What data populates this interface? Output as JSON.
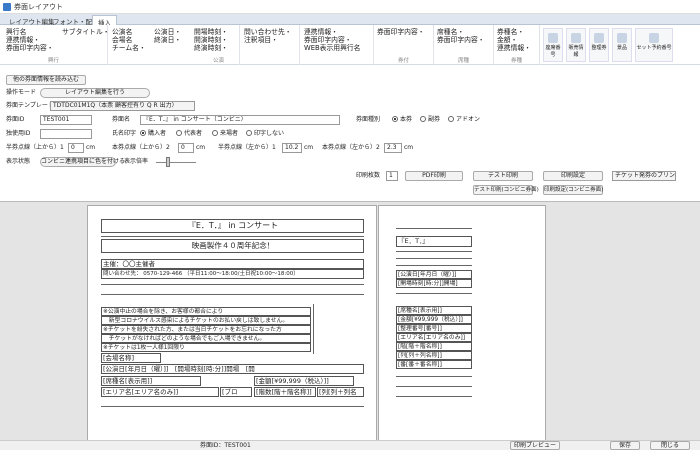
{
  "window": {
    "title": "券面レイアウト"
  },
  "tabs": [
    "レイアウト編集",
    "フォント・配置",
    "挿入"
  ],
  "ribbon": {
    "g1": {
      "items": [
        "興行名",
        "連携情報・",
        "券面印字内容・",
        "サブタイトル・"
      ],
      "label": "興行"
    },
    "g2": {
      "items": [
        "公演名",
        "会場名",
        "チーム名・"
      ]
    },
    "g3": {
      "items": [
        "公演日・",
        "終演日・"
      ]
    },
    "g4": {
      "items": [
        "開場時刻・",
        "開演時刻・",
        "終演時刻・"
      ],
      "label": "公演"
    },
    "g5": {
      "items": [
        "問い合わせ先・",
        "注釈項目・"
      ]
    },
    "g6": {
      "items": [
        "連携情報・",
        "券面印字内容・",
        "WEB表示用興行名"
      ]
    },
    "g7": {
      "items": [
        "券面印字内容・"
      ],
      "label": "券付"
    },
    "g8": {
      "items": [
        "席種名・",
        "券面印字内容・"
      ],
      "label": "席種"
    },
    "g9": {
      "items": [
        "券種名・",
        "金額・",
        "連携情報・"
      ],
      "label": "券種"
    },
    "big": [
      "座席番号",
      "販売情報",
      "整理券",
      "景品",
      "セット予約番号"
    ]
  },
  "form": {
    "load_button": "他の券面情報を読み込む",
    "mode_label": "操作モード",
    "mode_button": "レイアウト編集を行う",
    "template_label": "券面テンプレート",
    "template_value": "TDTDC01M1Q（本票 顧客控有り Q R 出力）",
    "id_label": "券面ID",
    "id_value": "TEST001",
    "name_label": "券面名",
    "name_value": "『E．T．』 in コンサート（コンビニ）",
    "type_label": "券面種別",
    "type_options": [
      "本券",
      "副券",
      "アドオン"
    ],
    "maker_label": "独使用ID",
    "print_label": "氏名印字",
    "print_options": [
      "購入者",
      "代表者",
      "来場者",
      "印字しない"
    ],
    "pos_top_label": "半券点線（上から）1",
    "pos_top_value": "0",
    "unit": "cm",
    "pos_top2_label": "本券点線（上から）2",
    "pos_top2_value": "0",
    "pos_left_label": "半券点線（左から）1",
    "pos_left_value": "10.2",
    "pos_left2_label": "本券点線（左から）2",
    "pos_left2_value": "2.3",
    "display_label": "表示状態",
    "display_button": "コンビニ連携項目に色を付ける",
    "zoom_label": "表示倍率",
    "copies_label": "印刷枚数",
    "copies_value": "1",
    "pdf_button": "PDF印刷",
    "test_print_button": "テスト印刷",
    "print_settings_button": "印刷設定",
    "printer_select": "チケット発券のプリンタ",
    "test_print_conv_button": "テスト印刷(コンビニ券面)",
    "print_settings_conv_button": "印刷設定(コンビニ券面)"
  },
  "ticket": {
    "title": "『E．T．』 in コンサート",
    "subtitle": "映画製作４０周年記念！",
    "organizer": "主催：〇〇主催者",
    "contact": "問い合わせ先： 0570-129-466 （平日11:00〜18:00/土日祝10:00〜18:00）",
    "notes": [
      "※公演中止の場合を除き、お客様の都合により",
      "　新型コロナウイルス感染によるチケットのお払い戻しは致しません。",
      "※チケットを紛失された方、または当日チケットをお忘れになった方",
      "　チケットがなければどのような場合でもご入場できません。",
      "※チケットは1枚一人様1回限り"
    ],
    "fields": [
      "[会場名称]",
      "[公演日[年月日（曜）]]　[開場時刻[時:分]]開場　[開",
      "[席種名[表示用]]",
      "[金額[¥99,999（税込）]]",
      "[エリア名[エリア名のみ]]",
      "[ブロ",
      "[階数[階＋階名称]]",
      "[列[列＋列名"
    ],
    "stub_title": "『E．T．』",
    "stub_fields": [
      "[公演日[年月日（曜）]]",
      "[開場時刻[時:分]]開場]",
      "[席種名[表示用]]",
      "[金額[¥99,999（税込）]]",
      "[整理番号[番号]]",
      "[エリア名[エリア名のみ]]",
      "[階[階＋階名称]]",
      "[列[列＋列名称]]",
      "[番[番＋番名称]]"
    ]
  },
  "footer": {
    "labels": [
      "券面ID：TEST001",
      "印刷プレビュー",
      "保存",
      "閉じる"
    ]
  }
}
